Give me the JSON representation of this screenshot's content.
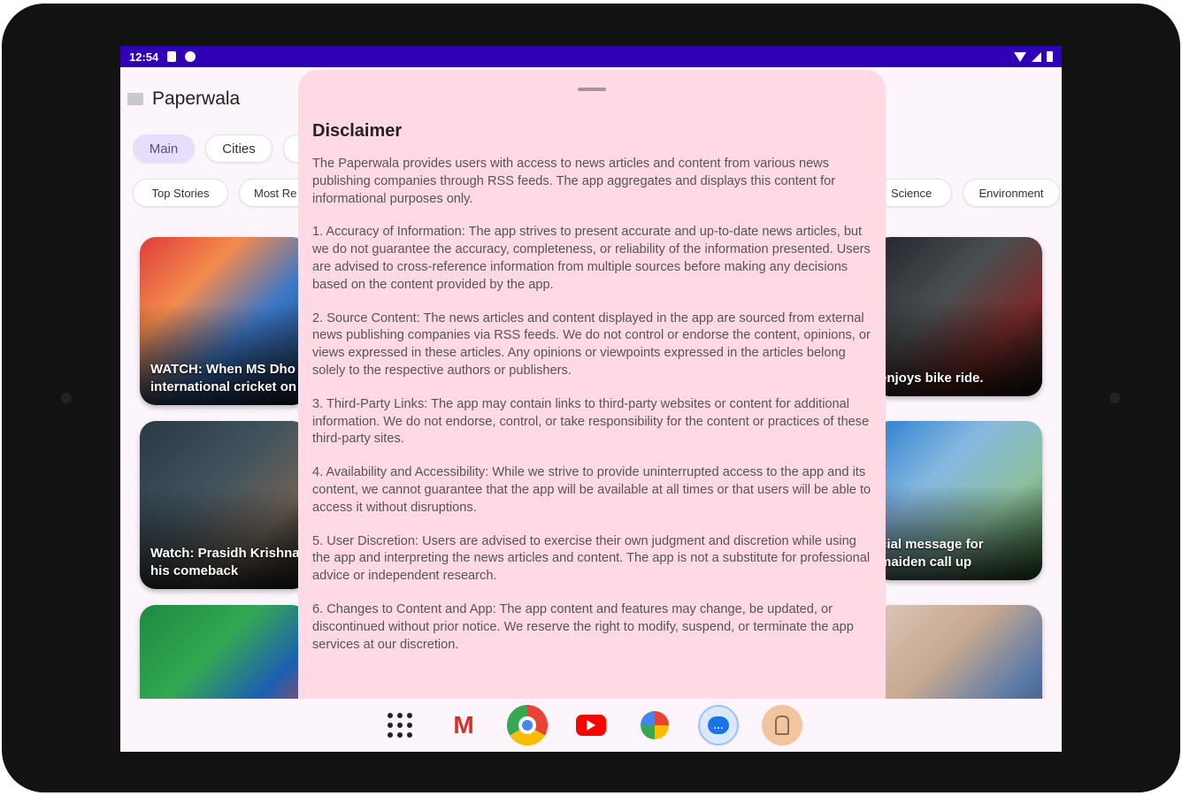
{
  "status_bar": {
    "time": "12:54"
  },
  "app": {
    "title": "Paperwala"
  },
  "tabs": [
    {
      "label": "Main",
      "selected": true
    },
    {
      "label": "Cities",
      "selected": false
    }
  ],
  "categories": [
    "Top Stories",
    "Most Re",
    "Science",
    "Environment"
  ],
  "cards": {
    "left": [
      "WATCH: When MS Dho\ninternational cricket on",
      "Watch: Prasidh Krishna\nhis comeback",
      ""
    ],
    "right": [
      "enjoys bike ride.",
      "cial message for\nmaiden call up",
      ""
    ]
  },
  "disclaimer": {
    "title": "Disclaimer",
    "paragraphs": [
      "The Paperwala provides users with access to news articles and content from various news publishing companies through RSS feeds. The app aggregates and displays this content for informational purposes only.",
      "1. Accuracy of Information: The app strives to present accurate and up-to-date news articles, but we do not guarantee the accuracy, completeness, or reliability of the information presented. Users are advised to cross-reference information from multiple sources before making any decisions based on the content provided by the app.",
      "2. Source Content: The news articles and content displayed in the app are sourced from external news publishing companies via RSS feeds. We do not control or endorse the content, opinions, or views expressed in these articles. Any opinions or viewpoints expressed in the articles belong solely to the respective authors or publishers.",
      "3. Third-Party Links: The app may contain links to third-party websites or content for additional information. We do not endorse, control, or take responsibility for the content or practices of these third-party sites.",
      "4. Availability and Accessibility: While we strive to provide uninterrupted access to the app and its content, we cannot guarantee that the app will be available at all times or that users will be able to access it without disruptions.",
      "5. User Discretion: Users are advised to exercise their own judgment and discretion while using the app and interpreting the news articles and content. The app is not a substitute for professional advice or independent research.",
      "6. Changes to Content and App: The app content and features may change, be updated, or discontinued without prior notice. We reserve the right to modify, suspend, or terminate the app services at our discretion."
    ]
  },
  "dock": {
    "icons": [
      "app-drawer-icon",
      "gmail-icon",
      "chrome-icon",
      "youtube-icon",
      "photos-icon",
      "messages-icon",
      "paperwala-icon"
    ],
    "gmail_glyph": "M",
    "messages_glyph": "…"
  },
  "colors": {
    "status_bar": "#2f00b8",
    "sheet": "#ffd9e4",
    "chip_selected": "#e7defc"
  }
}
